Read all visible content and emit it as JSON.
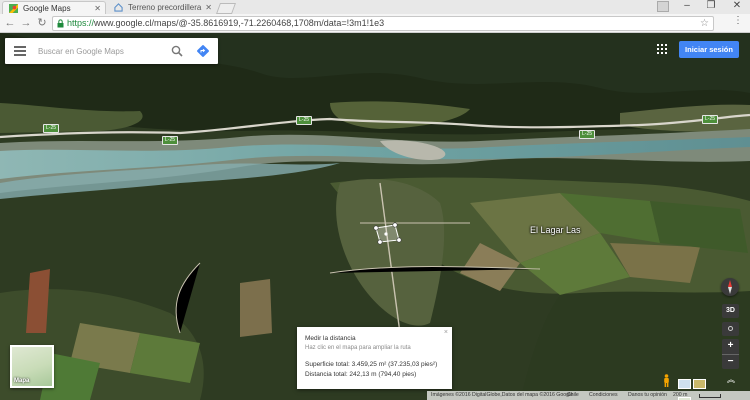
{
  "browser": {
    "tabs": [
      {
        "label": "Google Maps",
        "active": true
      },
      {
        "label": "Terreno precordillera lin…",
        "active": false
      }
    ],
    "url_scheme": "https://",
    "url_rest": "www.google.cl/maps/@-35.8616919,-71.2260468,1708m/data=!3m1!1e3",
    "window_buttons": [
      "–",
      "❐",
      "✕"
    ]
  },
  "search": {
    "placeholder": "Buscar en Google Maps"
  },
  "header": {
    "signin_label": "Iniciar sesión"
  },
  "map": {
    "place_label": "El Lagar Las",
    "highway_labels": [
      "L-25",
      "L-25",
      "L-25",
      "L-25",
      "L-25"
    ]
  },
  "measure_panel": {
    "title": "Medir la distancia",
    "hint": "Haz clic en el mapa para ampliar la ruta",
    "area": "Superficie total: 3.459,25 m² (37.235,03 pies²)",
    "distance": "Distancia total: 242,13 m (794,40 pies)"
  },
  "minimap": {
    "label": "Mapa"
  },
  "controls": {
    "three_d_label": "3D",
    "zoom_in": "+",
    "zoom_out": "−",
    "expand": "︽"
  },
  "footer": {
    "imagery": "Imágenes ©2016 DigitalGlobe,Datos del mapa ©2016 Google",
    "country": "Chile",
    "terms": "Condiciones",
    "feedback": "Danos tu opinión",
    "scale": "200 m"
  },
  "colors": {
    "signin": "#4285f4",
    "url_secure": "#1e8a3c",
    "highway_sign": "#4d8f3b"
  }
}
